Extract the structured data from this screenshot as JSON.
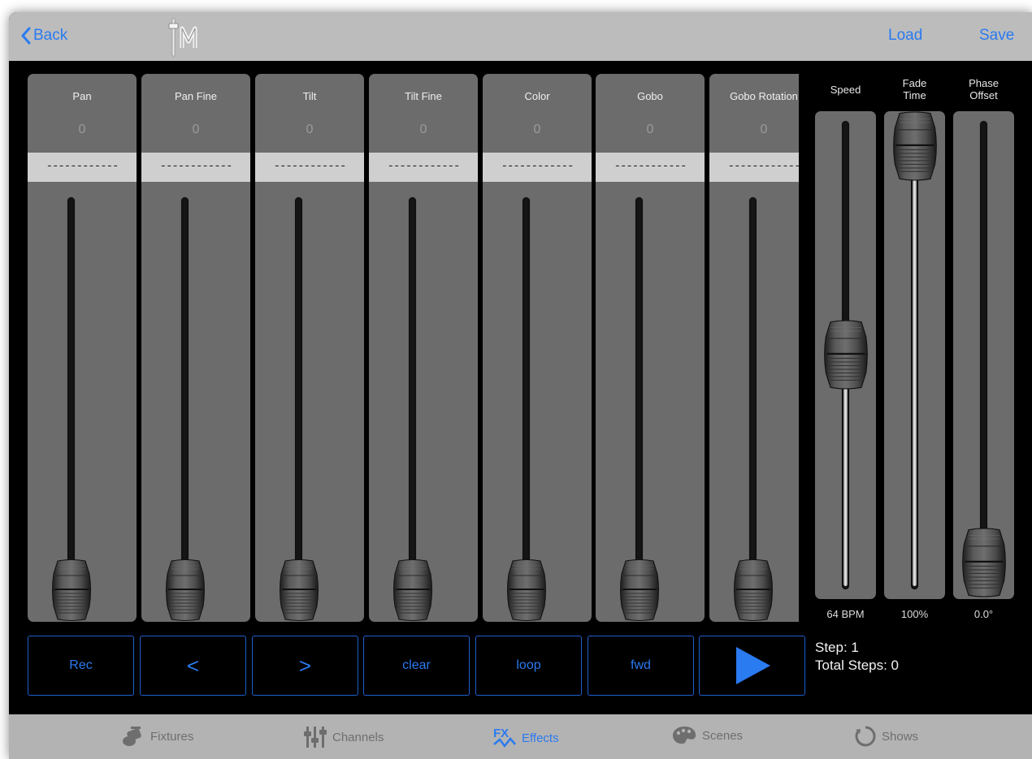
{
  "header": {
    "back_label": "Back",
    "load_label": "Load",
    "save_label": "Save"
  },
  "channels": [
    {
      "name": "Pan",
      "value": "0",
      "field": "------------",
      "level": 0
    },
    {
      "name": "Pan Fine",
      "value": "0",
      "field": "------------",
      "level": 0
    },
    {
      "name": "Tilt",
      "value": "0",
      "field": "------------",
      "level": 0
    },
    {
      "name": "Tilt Fine",
      "value": "0",
      "field": "------------",
      "level": 0
    },
    {
      "name": "Color",
      "value": "0",
      "field": "------------",
      "level": 0
    },
    {
      "name": "Gobo",
      "value": "0",
      "field": "------------",
      "level": 0
    },
    {
      "name": "Gobo Rotation",
      "value": "0",
      "field": "------------",
      "level": 0
    }
  ],
  "controls": {
    "speed": {
      "label": "Speed",
      "value": "64 BPM",
      "level": 0.5
    },
    "fade_time": {
      "label_line1": "Fade",
      "label_line2": "Time",
      "value": "100%",
      "level": 1.0
    },
    "phase_offset": {
      "label_line1": "Phase",
      "label_line2": "Offset",
      "value": "0.0°",
      "level": 0.0
    }
  },
  "buttons": {
    "rec": "Rec",
    "prev": "<",
    "next": ">",
    "clear": "clear",
    "loop": "loop",
    "fwd": "fwd"
  },
  "play_icon": "play-icon",
  "step": {
    "step_label": "Step: 1",
    "total_label": "Total Steps: 0"
  },
  "tabs": [
    {
      "label": "Fixtures",
      "icon": "fixtures-icon",
      "active": false
    },
    {
      "label": "Channels",
      "icon": "channels-icon",
      "active": false
    },
    {
      "label": "Effects",
      "icon": "effects-icon",
      "active": true
    },
    {
      "label": "Scenes",
      "icon": "scenes-icon",
      "active": false
    },
    {
      "label": "Shows",
      "icon": "shows-icon",
      "active": false
    }
  ],
  "colors": {
    "accent": "#2a7af0",
    "strip": "#6c6c6c",
    "bar": "#bcbcbc"
  }
}
